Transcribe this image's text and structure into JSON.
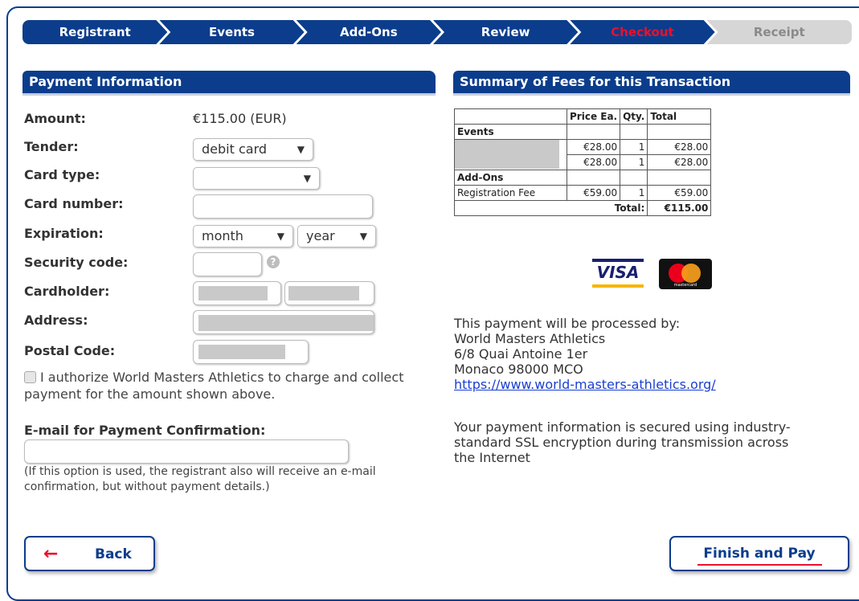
{
  "steps": [
    "Registrant",
    "Events",
    "Add-Ons",
    "Review",
    "Checkout",
    "Receipt"
  ],
  "payment": {
    "header": "Payment Information",
    "amount_label": "Amount:",
    "amount_value": "€115.00 (EUR)",
    "tender_label": "Tender:",
    "tender_value": "debit card",
    "card_type_label": "Card type:",
    "card_type_value": "",
    "card_number_label": "Card number:",
    "expiration_label": "Expiration:",
    "exp_month": "month",
    "exp_year": "year",
    "security_label": "Security code:",
    "help_glyph": "?",
    "cardholder_label": "Cardholder:",
    "address_label": "Address:",
    "postal_label": "Postal Code:",
    "authorize_text": "I authorize World Masters Athletics to charge and collect payment for the amount shown above.",
    "email_label": "E-mail for Payment Confirmation:",
    "email_note": "(If this option is used, the registrant also will receive an e-mail confirmation, but without payment details.)"
  },
  "summary": {
    "header": "Summary of Fees for this Transaction",
    "columns": [
      "",
      "Price Ea.",
      "Qty.",
      "Total"
    ],
    "events_label": "Events",
    "event_rows": [
      {
        "price": "€28.00",
        "qty": "1",
        "total": "€28.00"
      },
      {
        "price": "€28.00",
        "qty": "1",
        "total": "€28.00"
      }
    ],
    "addons_label": "Add-Ons",
    "addon_rows": [
      {
        "name": "Registration Fee",
        "price": "€59.00",
        "qty": "1",
        "total": "€59.00"
      }
    ],
    "total_label": "Total:",
    "total_value": "€115.00"
  },
  "cards": {
    "visa": "VISA",
    "mastercard": "mastercard"
  },
  "processor": {
    "intro": "This payment will be processed by:",
    "name": "World Masters Athletics",
    "address1": "6/8 Quai Antoine 1er",
    "address2": "Monaco 98000 MCO",
    "url": "https://www.world-masters-athletics.org/"
  },
  "secure_text": "Your payment information is secured using industry-standard SSL encryption during transmission across the Internet",
  "buttons": {
    "back_arrow": "←",
    "back": "Back",
    "finish": "Finish and Pay"
  },
  "colors": {
    "brand": "#0b3d8c",
    "accent": "#e8112d",
    "link": "#1a3fd0"
  }
}
